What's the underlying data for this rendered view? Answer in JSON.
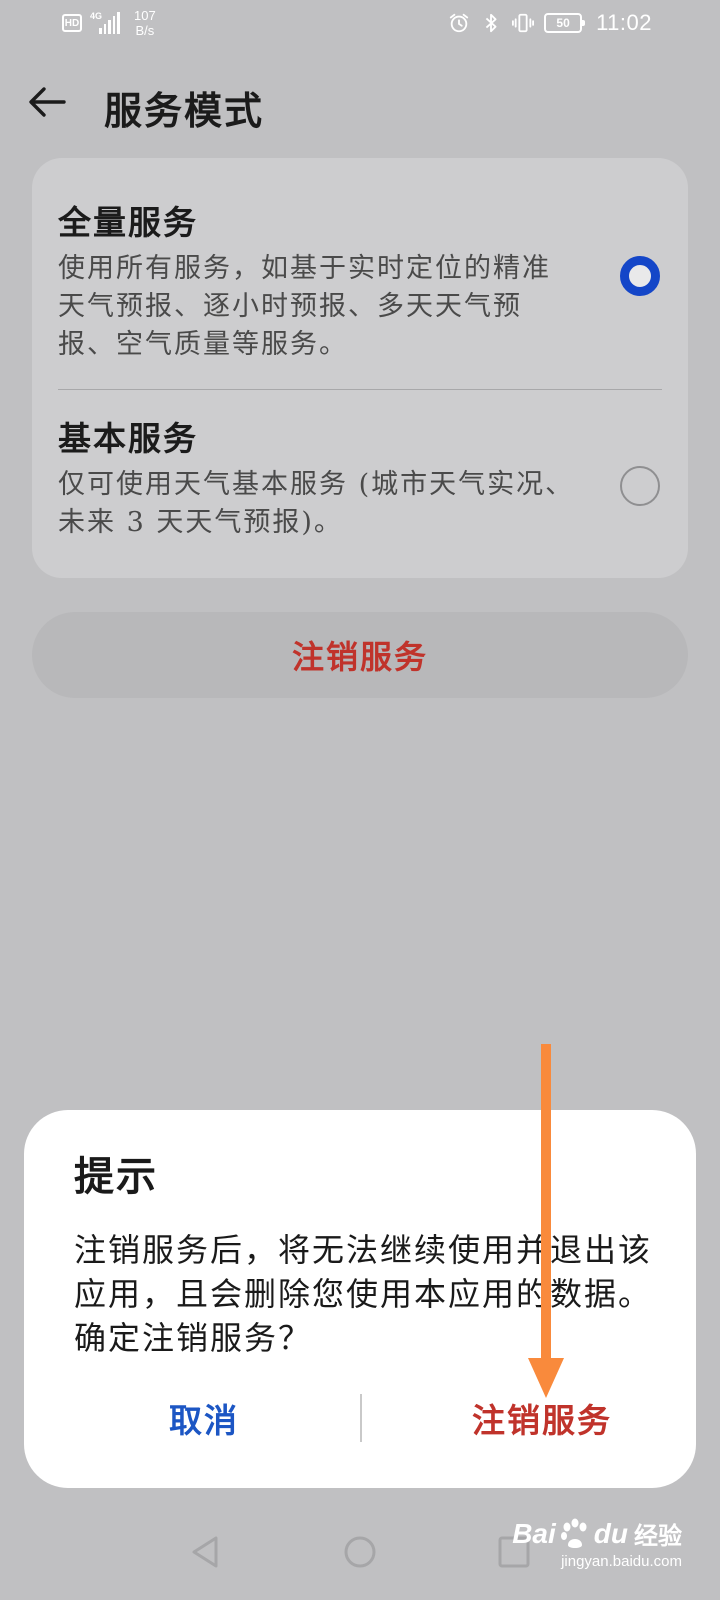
{
  "status_bar": {
    "hd": "HD",
    "network_type": "4G",
    "net_speed_value": "107",
    "net_speed_unit": "B/s",
    "battery": "50",
    "time": "11:02",
    "icons": [
      "alarm-icon",
      "bluetooth-icon",
      "vibrate-icon"
    ]
  },
  "app_bar": {
    "title": "服务模式",
    "back_icon": "arrow-left-icon"
  },
  "options": [
    {
      "title": "全量服务",
      "description": "使用所有服务，如基于实时定位的精准天气预报、逐小时预报、多天天气预报、空气质量等服务。",
      "selected": true
    },
    {
      "title": "基本服务",
      "description": "仅可使用天气基本服务 (城市天气实况、未来 3 天天气预报)。",
      "selected": false
    }
  ],
  "deregister_button": {
    "label": "注销服务"
  },
  "dialog": {
    "title": "提示",
    "message": "注销服务后，将无法继续使用并退出该应用，且会删除您使用本应用的数据。确定注销服务？",
    "cancel_label": "取消",
    "confirm_label": "注销服务"
  },
  "colors": {
    "accent_blue": "#1446c8",
    "danger_red": "#c0332b",
    "annotation_orange": "#f98a3c"
  },
  "nav_bar": {
    "icons": [
      "nav-back-icon",
      "nav-home-icon",
      "nav-recents-icon"
    ]
  },
  "watermark": {
    "brand_left": "Bai",
    "brand_right": "du",
    "brand_suffix": "经验",
    "url": "jingyan.baidu.com"
  }
}
